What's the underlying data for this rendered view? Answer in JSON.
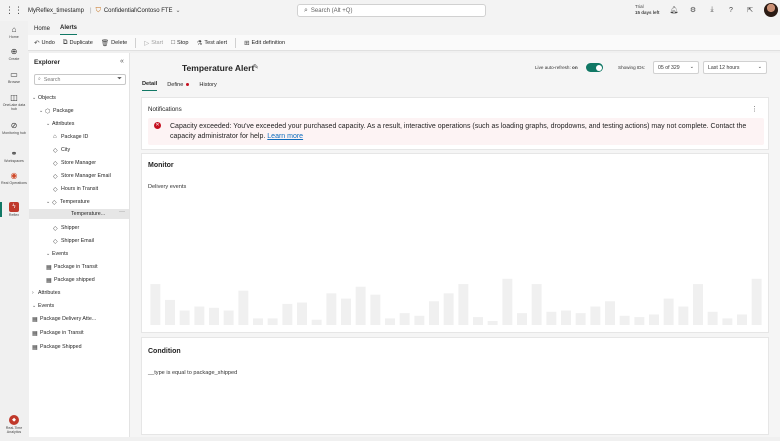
{
  "header": {
    "app_name": "MyReflex_timestamp",
    "separator": "|",
    "sensitivity_label": "Confidential\\Contoso FTE",
    "search_placeholder": "Search (Alt +Q)",
    "trial_label": "Trial",
    "trial_days": "15 days left",
    "icons": [
      "bell-icon",
      "gear-icon",
      "download-icon",
      "help-icon",
      "share-icon"
    ]
  },
  "left_rail": {
    "items": [
      {
        "label": "Home",
        "icon": "home-icon"
      },
      {
        "label": "Create",
        "icon": "plus-circle-icon"
      },
      {
        "label": "Browse",
        "icon": "folder-icon"
      },
      {
        "label": "OneLake data hub",
        "icon": "database-icon"
      },
      {
        "label": "Monitoring hub",
        "icon": "monitor-icon"
      },
      {
        "label": "Workspaces",
        "icon": "workspaces-icon"
      },
      {
        "label": "Real Operations",
        "icon": "realops-icon"
      },
      {
        "label": "Reflex",
        "icon": "reflex-icon"
      },
      {
        "label": "Real-Time Analytics",
        "icon": "rta-icon"
      }
    ]
  },
  "ribbon": {
    "tabs": [
      {
        "label": "Home"
      },
      {
        "label": "Alerts"
      }
    ],
    "active_tab": "Alerts",
    "buttons": {
      "undo": "Undo",
      "duplicate": "Duplicate",
      "delete": "Delete",
      "start": "Start",
      "stop": "Stop",
      "test_alert": "Test alert",
      "edit_definition": "Edit definition"
    }
  },
  "explorer": {
    "title": "Explorer",
    "search_placeholder": "Search",
    "tree": [
      {
        "label": "Objects"
      },
      {
        "label": "Package"
      },
      {
        "label": "Attributes"
      },
      {
        "label": "Package ID"
      },
      {
        "label": "City"
      },
      {
        "label": "Store Manager"
      },
      {
        "label": "Store Manager Email"
      },
      {
        "label": "Hours in Transit"
      },
      {
        "label": "Temperature"
      },
      {
        "label": "Temperature..."
      },
      {
        "label": "Shipper"
      },
      {
        "label": "Shipper Email"
      },
      {
        "label": "Events"
      },
      {
        "label": "Package in Transit"
      },
      {
        "label": "Package shipped"
      },
      {
        "label": "Attributes"
      },
      {
        "label": "Events"
      },
      {
        "label": "Package Delivery Atte..."
      },
      {
        "label": "Package in Transit"
      },
      {
        "label": "Package Shipped"
      }
    ]
  },
  "alert": {
    "title": "Temperature Alert",
    "auto_refresh_label": "Live auto-refresh:",
    "auto_refresh_state": "on",
    "auto_refresh_on": true,
    "showing_label": "Showing IDs:",
    "ids_range": "05 of 329",
    "time_range": "Last 12 hours",
    "tabs": [
      {
        "label": "Detail"
      },
      {
        "label": "Define"
      },
      {
        "label": "History"
      }
    ],
    "active_tab": "Detail"
  },
  "notifications": {
    "title": "Notifications",
    "message": "Capacity exceeded: You've exceeded your purchased capacity. As a result, interactive operations (such as loading graphs, dropdowns, and testing actions) may not complete. Contact the capacity administrator for help.",
    "link_text": "Learn more"
  },
  "monitor": {
    "title": "Monitor",
    "subtitle": "Delivery events"
  },
  "chart_data": {
    "type": "bar",
    "values": [
      0.62,
      0.38,
      0.22,
      0.28,
      0.26,
      0.22,
      0.52,
      0.1,
      0.1,
      0.32,
      0.34,
      0.08,
      0.48,
      0.4,
      0.58,
      0.46,
      0.1,
      0.18,
      0.14,
      0.36,
      0.48,
      0.62,
      0.12,
      0.06,
      0.7,
      0.18,
      0.62,
      0.2,
      0.22,
      0.18,
      0.28,
      0.36,
      0.14,
      0.12,
      0.16,
      0.4,
      0.28,
      0.62,
      0.2,
      0.1,
      0.16,
      0.7
    ],
    "ylim": [
      0,
      1
    ],
    "grid": false,
    "legend": false,
    "bar_color": "#f0f0f0"
  },
  "condition": {
    "title": "Condition",
    "text": "__type is equal to package_shipped"
  }
}
